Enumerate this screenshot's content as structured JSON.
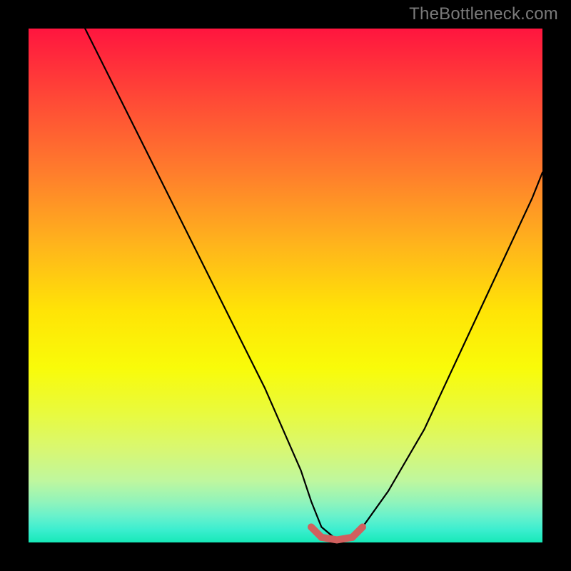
{
  "watermark": "TheBottleneck.com",
  "chart_data": {
    "type": "line",
    "title": "",
    "xlabel": "",
    "ylabel": "",
    "xlim": [
      0,
      100
    ],
    "ylim": [
      0,
      100
    ],
    "note": "Unlabeled V-shaped curve over a vertical color gradient; values are estimated pixel positions normalized to 0–100.",
    "series": [
      {
        "name": "main-curve",
        "x": [
          11,
          18,
          25,
          32,
          39,
          46,
          53,
          55,
          57,
          60,
          63,
          65,
          70,
          77,
          84,
          91,
          98,
          100
        ],
        "values": [
          100,
          86,
          72,
          58,
          44,
          30,
          14,
          8,
          3,
          0.5,
          0.5,
          3,
          10,
          22,
          37,
          52,
          67,
          72
        ]
      },
      {
        "name": "highlight-segment",
        "x": [
          55,
          57,
          60,
          63,
          65
        ],
        "values": [
          3,
          1,
          0.5,
          1,
          3
        ]
      }
    ],
    "colors": {
      "curve": "#000000",
      "highlight": "#d1605e",
      "gradient_top": "#ff153f",
      "gradient_bottom": "#16e9b8"
    }
  }
}
